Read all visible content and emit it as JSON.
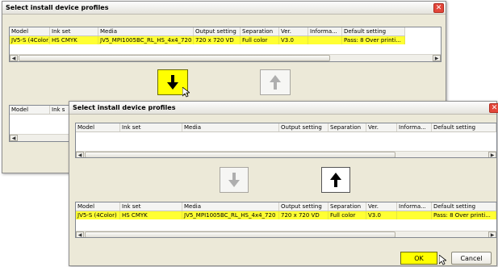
{
  "back_dialog": {
    "title": "Select install device profiles",
    "columns": [
      "Model",
      "Ink set",
      "Media",
      "Output setting",
      "Separation",
      "Ver.",
      "Informa...",
      "Default setting"
    ],
    "row": [
      "JV5-S (4Color)",
      "HS CMYK",
      "JV5_MPI1005BC_RL_HS_4x4_720",
      "720 x 720 VD",
      "Full color",
      "V3.0",
      "",
      "Pass: 8  Over printi..."
    ],
    "lower_columns": [
      "Model",
      "Ink s"
    ],
    "down_arrow": "down-arrow",
    "up_arrow": "up-arrow"
  },
  "front_dialog": {
    "title": "Select install device profiles",
    "columns": [
      "Model",
      "Ink set",
      "Media",
      "Output setting",
      "Separation",
      "Ver.",
      "Informa...",
      "Default setting"
    ],
    "row": [
      "JV5-S (4Color)",
      "HS CMYK",
      "JV5_MPI1005BC_RL_HS_4x4_720",
      "720 x 720 VD",
      "Full color",
      "V3.0",
      "",
      "Pass: 8  Over printi..."
    ],
    "ok_label": "OK",
    "cancel_label": "Cancel"
  },
  "colors": {
    "highlight": "#ffff33",
    "button_yellow": "#ffff00",
    "close_red": "#e2463a"
  }
}
